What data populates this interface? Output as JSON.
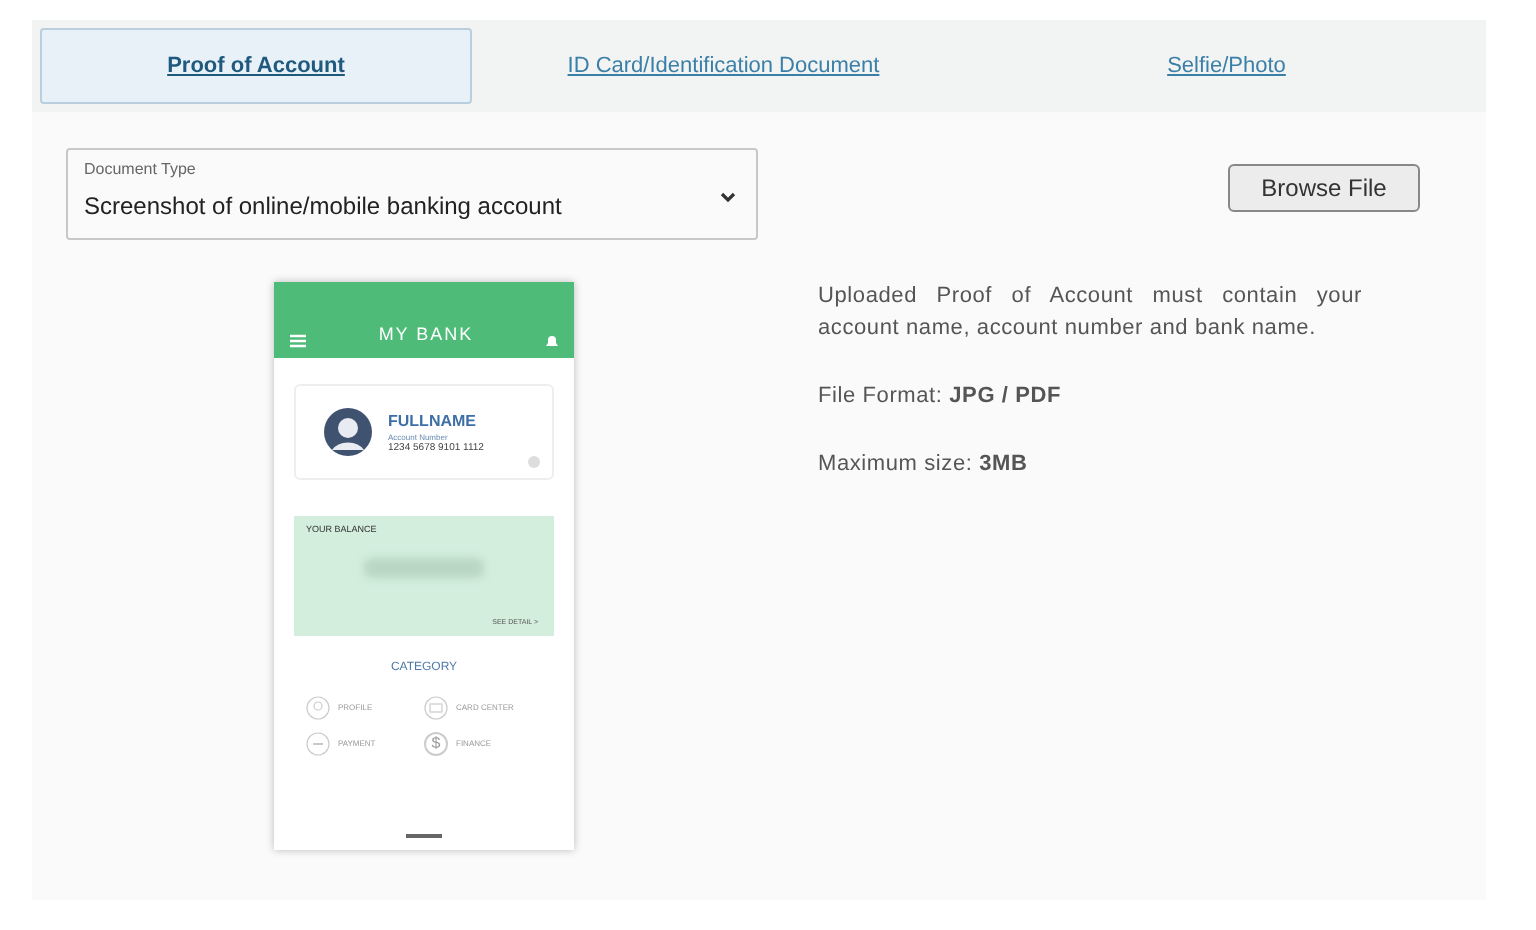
{
  "tabs": [
    {
      "label": "Proof of Account",
      "selected": true
    },
    {
      "label": "ID Card/Identification Document",
      "selected": false
    },
    {
      "label": "Selfie/Photo",
      "selected": false
    }
  ],
  "document_type": {
    "label": "Document Type",
    "value": "Screenshot of online/mobile banking account"
  },
  "browse_button": "Browse File",
  "sample_phone": {
    "app_title": "MY BANK",
    "name": "FULLNAME",
    "account_label": "Account Number",
    "account_number": "1234 5678 9101 1112",
    "balance_label": "YOUR BALANCE",
    "detail_link": "SEE DETAIL >",
    "category_title": "CATEGORY",
    "categories": [
      {
        "label": "PROFILE",
        "kind": "person"
      },
      {
        "label": "CARD CENTER",
        "kind": "card"
      },
      {
        "label": "PAYMENT",
        "kind": "bill"
      },
      {
        "label": "FINANCE",
        "kind": "dollar",
        "icon_text": "$"
      }
    ]
  },
  "info": {
    "description": "Uploaded Proof of Account must contain your account name, account number and bank name.",
    "format": "File Format: **JPG / PDF**",
    "size": "Maximum size: **3MB**"
  }
}
